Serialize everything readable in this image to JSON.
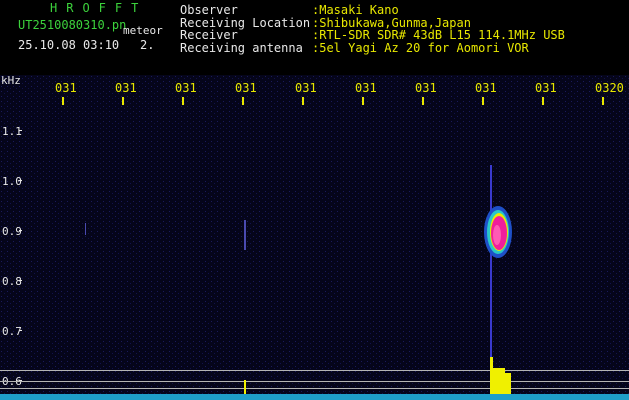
{
  "header": {
    "brand": "HROFFT",
    "filename": "UT2510080310.pn",
    "mode": "meteor",
    "datetime": "25.10.08 03:10",
    "count": "2."
  },
  "info": [
    {
      "label": "Observer",
      "value": ":Masaki Kano"
    },
    {
      "label": "Receiving Location",
      "value": ":Shibukawa,Gunma,Japan"
    },
    {
      "label": "Receiver",
      "value": ":RTL-SDR SDR# 43dB L15 114.1MHz USB"
    },
    {
      "label": "Receiving antenna",
      "value": ":5el Yagi Az 20 for Aomori VOR"
    }
  ],
  "axis": {
    "unit": "kHz",
    "time_ticks": [
      "031",
      "031",
      "031",
      "031",
      "031",
      "031",
      "031",
      "031",
      "031",
      "0320"
    ],
    "freq_ticks": [
      "1.1",
      "1.0",
      "0.9",
      "0.8",
      "0.7",
      "0.6"
    ]
  },
  "colors": {
    "header_green": "#3cd23c",
    "info_yellow": "#e8e800",
    "label_white": "#e8e8e8",
    "background": "#000000",
    "plot_bg": "#05051a",
    "tick_yellow": "#e8e800"
  }
}
